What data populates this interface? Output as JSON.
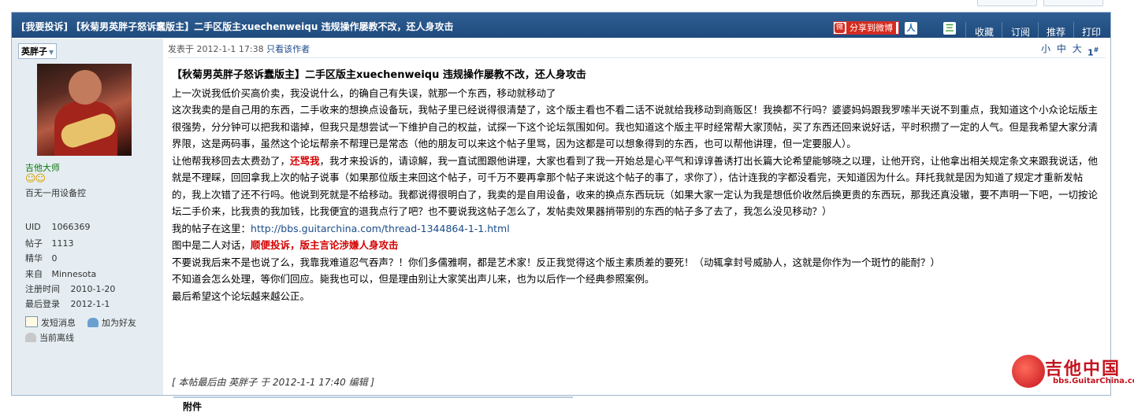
{
  "title": {
    "text": "[我要投诉] 【秋菊男英胖子怒诉蠢版主】二手区版主xuechenweiqu 违规操作屡教不改，还人身攻击",
    "share_label": "分享到微博",
    "actions": [
      "收藏",
      "订阅",
      "推荐",
      "打印"
    ]
  },
  "author": {
    "name": "英胖子",
    "rank": "吉他大师",
    "custom_title": "百无一用设备控",
    "stats": [
      {
        "k": "UID",
        "v": "1066369"
      },
      {
        "k": "帖子",
        "v": "1113"
      },
      {
        "k": "精华",
        "v": "0"
      },
      {
        "k": "来自",
        "v": "Minnesota"
      },
      {
        "k": "注册时间",
        "v": "2010-1-20"
      },
      {
        "k": "最后登录",
        "v": "2012-1-1"
      }
    ],
    "actions": {
      "send_pm": "发短消息",
      "add_friend": "加为好友",
      "status": "当前离线"
    }
  },
  "post": {
    "meta_prefix": "发表于 2012-1-1 17:38",
    "only_author": "只看该作者",
    "font_sizes": [
      "小",
      "中",
      "大"
    ],
    "floor": "1",
    "floor_suffix": "#",
    "heading": "【秋菊男英胖子怒诉蠢版主】二手区版主xuechenweiqu 违规操作屡教不改，还人身攻击",
    "p1": "上一次说我低价买高价卖，我没说什么，的确自己有失误，就那一个东西，移动就移动了",
    "p2": "这次我卖的是自己用的东西，二手收来的想换点设备玩，我帖子里已经说得很清楚了，这个版主看也不看二话不说就给我移动到商贩区！我换都不行吗？婆婆妈妈跟我罗嗦半天说不到重点，我知道这个小众论坛版主很强势，分分钟可以把我和谐掉，但我只是想尝试一下维护自己的权益，试探一下这个论坛氛围如何。我也知道这个版主平时经常帮大家顶帖，买了东西还回来说好话，平时积攒了一定的人气。但是我希望大家分清界限，这是两码事，虽然这个论坛帮亲不帮理已是常态（他的朋友可以来这个帖子里骂，因为这都是可以想象得到的东西，也可以帮他讲理，但一定要服人）。",
    "p3_a": "让他帮我移回去太费劲了，",
    "p3_red": "还骂我",
    "p3_b": "，我才来投诉的，请谅解，我一直试图跟他讲理，大家也看到了我一开始总是心平气和谆谆善诱打出长篇大论希望能够晓之以理，让他开窍，让他拿出相关规定条文来跟我说话，他就是不理睬，回回拿我上次的帖子说事（如果那位版主来回这个帖子，可千万不要再拿那个帖子来说这个帖子的事了，求你了），估计连我的字都没看完，天知道因为什么。拜托我就是因为知道了规定才重新发帖的，我上次错了还不行吗。他说到死就是不给移动。我都说得很明白了，我卖的是自用设备，收来的换点东西玩玩（如果大家一定认为我是想低价收然后换更贵的东西玩，那我还真没辙，要不声明一下吧，一切按论坛二手价来，比我贵的我加钱，比我便宜的退我点行了吧？也不要说我这帖子怎么了，发帖卖效果器捎带别的东西的帖子多了去了，我怎么没见移动？）",
    "p4_a": "我的帖子在这里：",
    "p4_link": "http://bbs.guitarchina.com/thread-1344864-1-1.html",
    "p5_a": "图中是二人对话，",
    "p5_red": "顺便投诉，版主言论涉嫌人身攻击",
    "p6": "不要说我后来不是也说了么，我靠我难道忍气吞声？！你们多儒雅啊，都是艺术家！反正我觉得这个版主素质差的要死！（动辄拿封号威胁人，这就是你作为一个斑竹的能耐？）",
    "p7": "不知道会怎么处理，等你们回应。毙我也可以，但是理由别让大家笑出声儿来，也为以后作一个经典参照案例。",
    "p8": "最后希望这个论坛越来越公正。",
    "edit_note": "[ 本帖最后由 英胖子 于 2012-1-1 17:40 编辑 ]",
    "attach_label": "附件"
  },
  "logo": {
    "cn": "吉他中国",
    "url": "bbs.GuitarChina.com"
  },
  "colors": {
    "titlebar": "#1f4a7d",
    "author_bg": "#e5edf2",
    "link": "#1a4c8a",
    "red": "#d40000",
    "rank": "#0a7a0a"
  }
}
